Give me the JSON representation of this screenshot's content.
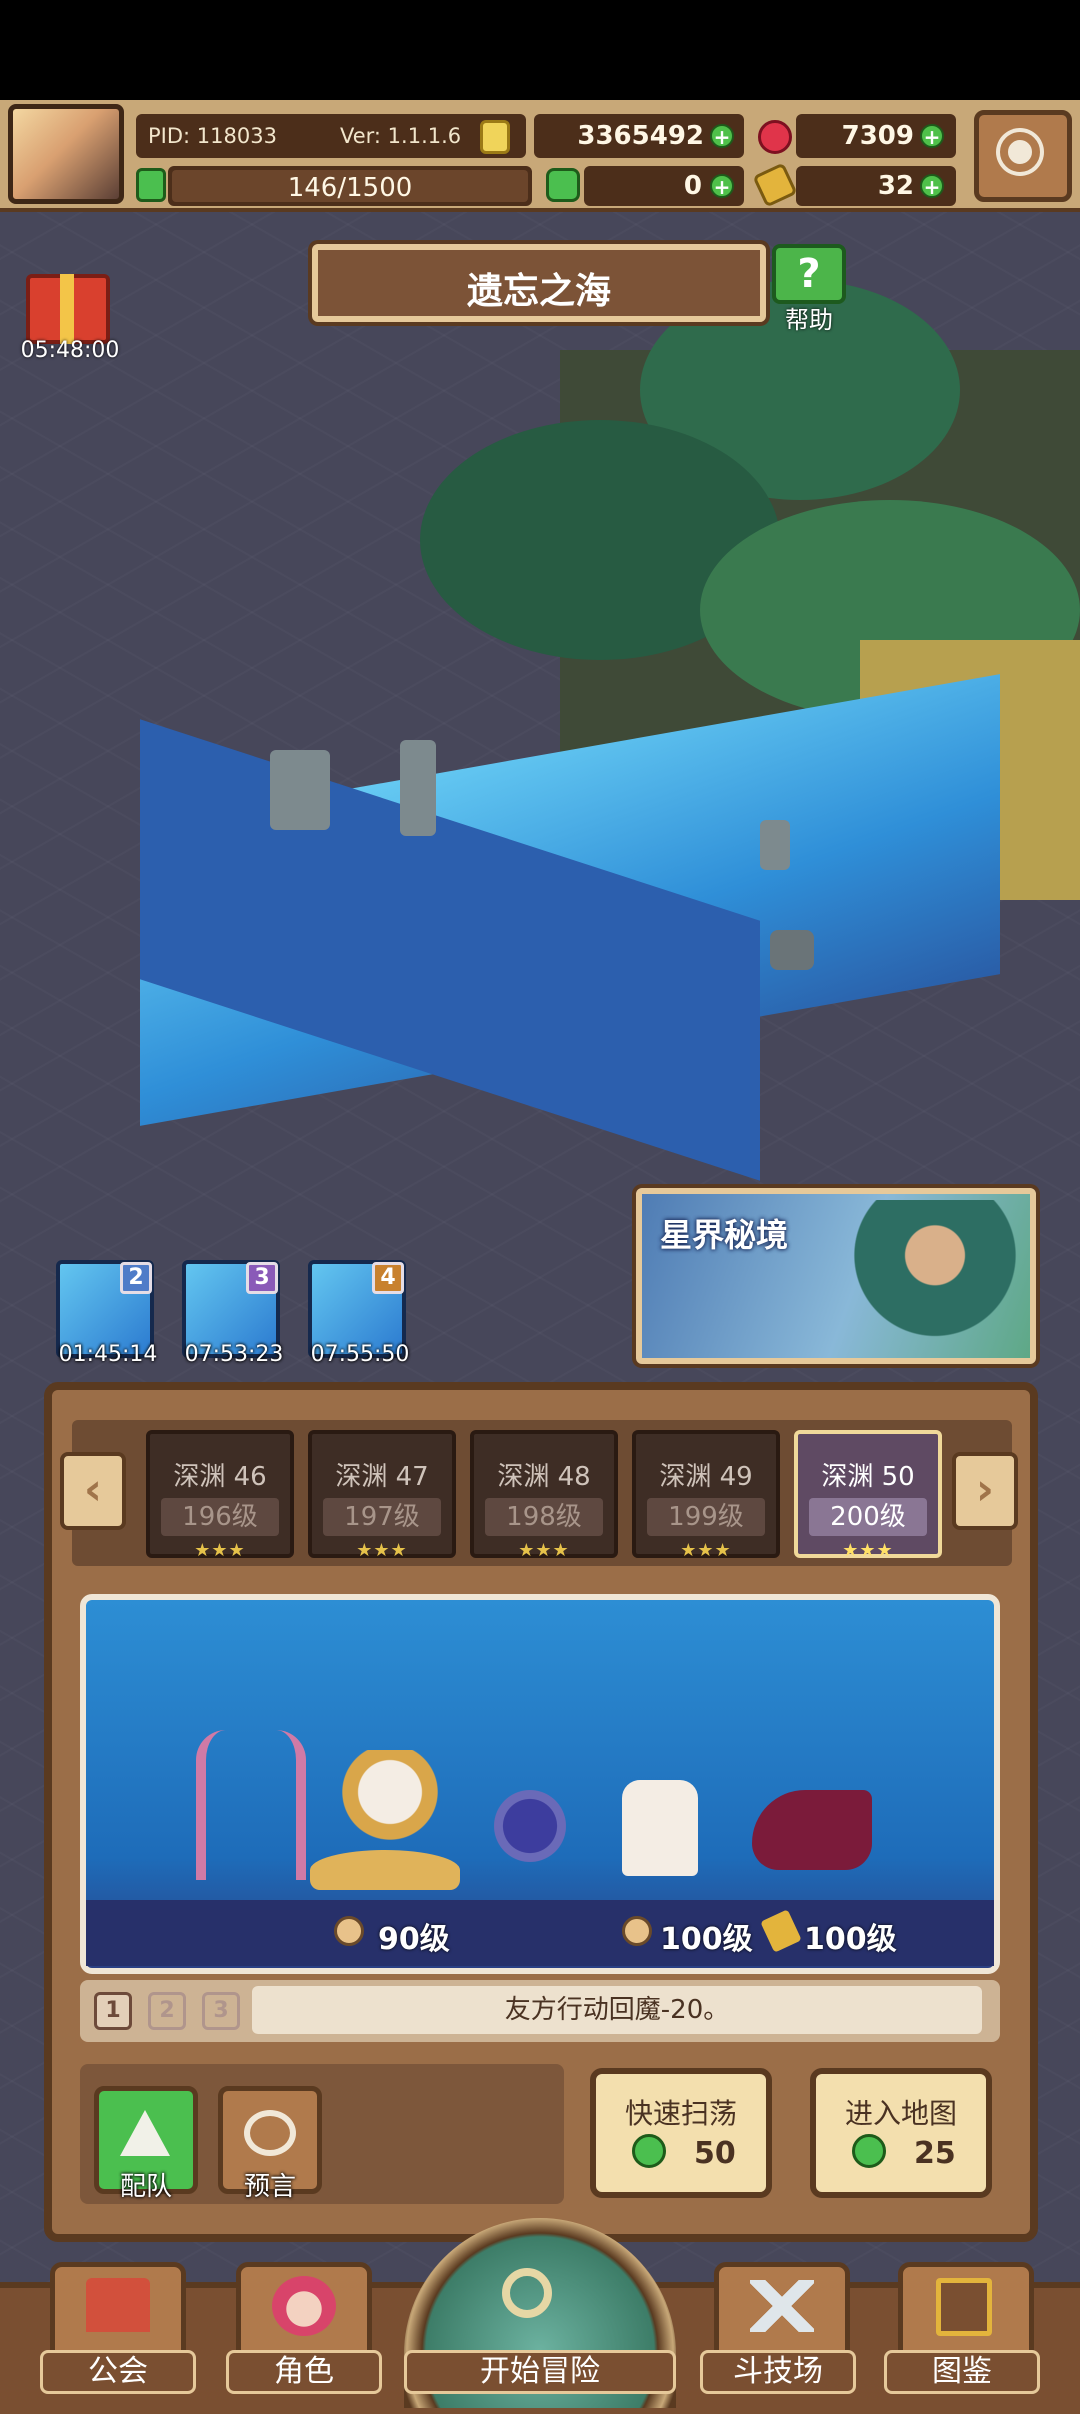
{
  "header": {
    "pid": "PID: 118033",
    "version": "Ver: 1.1.1.6",
    "gold": "3365492",
    "ruby": "7309",
    "stamina": "146/1500",
    "clover": "0",
    "key": "32"
  },
  "location": {
    "title": "遗忘之海",
    "help_label": "帮助"
  },
  "gift": {
    "timer": "05:48:00"
  },
  "portals": [
    {
      "badge": "2",
      "timer": "01:45:14",
      "badge_color": "#4f7cc8"
    },
    {
      "badge": "3",
      "timer": "07:53:23",
      "badge_color": "#8a5ab8"
    },
    {
      "badge": "4",
      "timer": "07:55:50",
      "badge_color": "#c8812e"
    }
  ],
  "star_realm": {
    "title": "星界秘境"
  },
  "stages": [
    {
      "name": "深渊 46",
      "level": "196级",
      "stars": "★★★"
    },
    {
      "name": "深渊 47",
      "level": "197级",
      "stars": "★★★"
    },
    {
      "name": "深渊 48",
      "level": "198级",
      "stars": "★★★"
    },
    {
      "name": "深渊 49",
      "level": "199级",
      "stars": "★★★"
    },
    {
      "name": "深渊 50",
      "level": "200级",
      "stars": "★★★"
    }
  ],
  "enemies": {
    "level_a": "90级",
    "level_b": "100级",
    "level_c": "100级"
  },
  "skill": {
    "tabs": [
      "1",
      "2",
      "3"
    ],
    "text": "友方行动回魔-20。"
  },
  "actions": {
    "team_label": "配队",
    "prophecy_label": "预言",
    "quick_sweep_label": "快速扫荡",
    "quick_sweep_cost": "50",
    "enter_map_label": "进入地图",
    "enter_map_cost": "25"
  },
  "nav": {
    "guild": "公会",
    "character": "角色",
    "adventure": "开始冒险",
    "arena": "斗技场",
    "codex": "图鉴"
  },
  "colors": {
    "accent_gold": "#e6c99a",
    "panel_brown": "#9b6e48",
    "dark_brown": "#5a3a20",
    "green_gem": "#4bbf4f",
    "ruby_red": "#e0344a"
  }
}
